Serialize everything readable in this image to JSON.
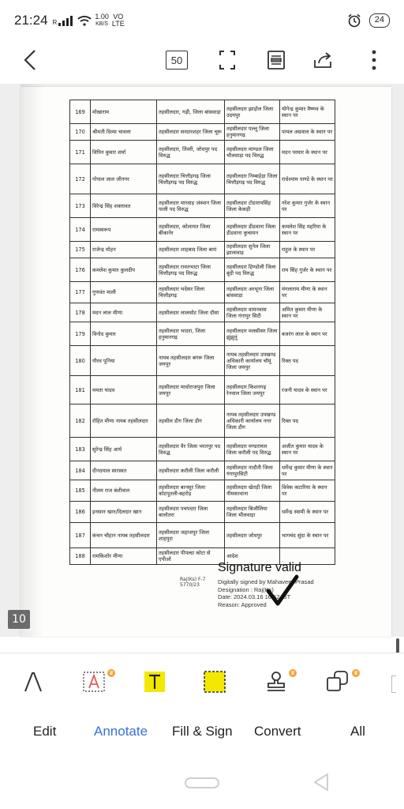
{
  "status_bar": {
    "time": "21:24",
    "network_letter": "R",
    "data_rate_value": "1.00",
    "data_rate_unit": "KB/S",
    "volte_top": "VO",
    "volte_bottom": "LTE",
    "battery": "24"
  },
  "toolbar": {
    "back_icon": "chevron-left-icon",
    "page_count": "50",
    "icons": [
      "fit-screen-icon",
      "reading-mode-icon",
      "share-icon",
      "more-vertical-icon"
    ]
  },
  "document": {
    "rows": [
      {
        "sn": "169",
        "name": "मोखाराम",
        "from": "तहसीलदार, गढ़ी, जिला बांसवाड़ा",
        "to": "तहसीलदार झाड़ोल जिला उदयपुर",
        "remark": "योगेन्द्र कुमार वैष्णव के स्थान पर"
      },
      {
        "sn": "170",
        "name": "श्रीमती दिव्या चावला",
        "from": "तहसीलदार सरदारशहर जिला चूरू",
        "to": "तहसीलदार पल्लू जिला हनुमानगढ़",
        "remark": "पायल अग्रवाल के स्थान पर"
      },
      {
        "sn": "171",
        "name": "विपिन कुमार शर्मा",
        "from": "तहसीलदार, तिंवरी, जोधपुर पद विरुद्ध",
        "to": "तहसीलदार माण्डल जिला भीलवाड़ा पद विरुद्ध",
        "remark": "मदन परमार के स्थान पर"
      },
      {
        "sn": "172",
        "name": "गोपाल लाल जीनगर",
        "from": "तहसीलदार चित्तौड़गढ़ जिला चित्तौड़गढ़ पद विरुद्ध",
        "to": "तहसीलदार निम्बाहेड़ा जिला चित्तौड़गढ़ पद विरुद्ध",
        "remark": "राधेश्याम पाण्डे के स्थान पर"
      },
      {
        "sn": "173",
        "name": "विरेन्द्र सिंह शक्तावत",
        "from": "तहसीलदार मारवाड़ जंक्शन जिला पाली पद विरुद्ध",
        "to": "तहसीलदार टोडारायसिंह जिला केकड़ी",
        "remark": "नरेश कुमार गुर्जर के स्थान पर"
      },
      {
        "sn": "174",
        "name": "रामस्वरूप",
        "from": "तहसीलदार, कोलायत जिला बीकानेर",
        "to": "तहसीलदार डीडवाना जिला डीडवाना कुचामन",
        "remark": "कमलेश सिंह महरिया के स्थान पर"
      },
      {
        "sn": "175",
        "name": "राजेन्द्र मोहन",
        "from": "तहसीलदार शाहबाद जिला बारां",
        "to": "तहसीलदार सुनेल जिला झालावाड़",
        "remark": "राहुल के स्थान पर"
      },
      {
        "sn": "176",
        "name": "कमलेश कुमार कुलदीप",
        "from": "तहसीलदार रावतभाटा जिला चित्तौड़गढ़ पद विरुद्ध",
        "to": "तहसीलदार हिण्डोली जिला बूंदी पद विरुद्ध",
        "remark": "राम सिंह गुर्जर के स्थान पर"
      },
      {
        "sn": "177",
        "name": "गुणवंत माली",
        "from": "तहसीलदार भदेसर जिला चित्तौड़गढ़",
        "to": "तहसीलदार अरथूना जिला बांसवाड़ा",
        "remark": "मंगलाराम मीणा के स्थान पर"
      },
      {
        "sn": "178",
        "name": "मदन लाल मीणा",
        "from": "तहसीलदार लालसोट जिला दौसा",
        "to": "तहसीलदार वामनवास जिला गंगापुर सिटी",
        "remark": "अमित कुमार मीणा के स्थान पर"
      },
      {
        "sn": "179",
        "name": "विनोद कुमार",
        "from": "तहसीलदार भादरा, जिला हनुमानगढ़",
        "to": "तहसीलदार मलसीसर जिला झुंझुनूं",
        "remark": "बजरंग लाल के स्थान पर"
      },
      {
        "sn": "180",
        "name": "गौरव पूनिया",
        "from": "नायब तहसीलदार बगरू जिला जयपुर",
        "to": "नायब तहसीलदार उपखण्ड अधिकारी कार्यालय चौमूं जिला जयपुर",
        "remark": "रिक्त पद"
      },
      {
        "sn": "181",
        "name": "ममता यादव",
        "from": "तहसीलदार माधोराजपुरा जिला जयपुर",
        "to": "तहसीलदार किशनगढ़ रेनवाल जिला जयपुर",
        "remark": "रजनी यादव के स्थान पर"
      },
      {
        "sn": "182",
        "name": "रोहित मीणा नायब तहसीलदार",
        "from": "तहसील डीग जिला डीग",
        "to": "नायब तहसीलदार उपखण्ड अधिकारी कार्यालय नगर जिला डीग",
        "remark": "रिक्त पद"
      },
      {
        "sn": "183",
        "name": "सुरेन्द्र सिंह आर्य",
        "from": "तहसीलदार वैर जिला भरतपुर पद विरुद्ध",
        "to": "तहसीलदार मण्डरायल जिला करौली पद विरुद्ध",
        "remark": "अजीत कुमार यादव के स्थान पर"
      },
      {
        "sn": "184",
        "name": "दीनदयाल सारस्वत",
        "from": "तहसीलदार करौली जिला करौली",
        "to": "तहसीलदार नादौती जिला गंगापुरसिटी",
        "remark": "धर्मेन्द्र कुमार मीणा के स्थान पर"
      },
      {
        "sn": "185",
        "name": "नीलम राज बंशीवाल",
        "from": "तहसीलदार बानसूर जिला कोटपूतली-बहरोड़",
        "to": "तहसीलदार खेतड़ी जिला नीमकाथाना",
        "remark": "विवेक कटारिया के स्थान पर"
      },
      {
        "sn": "186",
        "name": "इनसान खान/दिलदार खान",
        "from": "तहसीलदार पचपदरा जिला बालोतरा",
        "to": "तहसीलदार बिजौलिया जिला भीलवाड़ा",
        "remark": "धर्मेन्द्र स्वामी के स्थान पर"
      },
      {
        "sn": "187",
        "name": "कंचन चौहान नायब तहसीलदार",
        "from": "तहसीलदार जहाजपुर जिला शाहपुरा",
        "to": "तहसीलदार जोधपुर",
        "remark": "भागचंद सुंदा के स्थान पर"
      },
      {
        "sn": "188",
        "name": "रामकिशोर मीणा",
        "from": "तहसीलदार पीपल्दा कोटा से एपीओ",
        "to": "आदेश",
        "remark": ""
      }
    ],
    "signature": {
      "title": "Signature valid",
      "line1": "Digitally signed by Mahaveer Prasad",
      "line2": "Designation : Raj(Ks)",
      "line3": "Date: 2024.03.16 16:52 IST",
      "line4": "Reason: Approved",
      "stamp": "Raj(Ks) F-7",
      "stamp_code": "5770/23"
    },
    "current_page": "10"
  },
  "annotate_tools": [
    {
      "name": "pen-tool-icon"
    },
    {
      "name": "text-box-tool-icon"
    },
    {
      "name": "highlight-text-tool-icon"
    },
    {
      "name": "area-highlight-tool-icon"
    },
    {
      "name": "stamp-tool-icon"
    },
    {
      "name": "shapes-tool-icon"
    }
  ],
  "tabs": {
    "edit": "Edit",
    "annotate": "Annotate",
    "fill_sign": "Fill & Sign",
    "convert": "Convert",
    "all": "All"
  },
  "colors": {
    "accent": "#3a6fd8",
    "highlight": "#f5e800",
    "premium": "#f2a33a"
  }
}
